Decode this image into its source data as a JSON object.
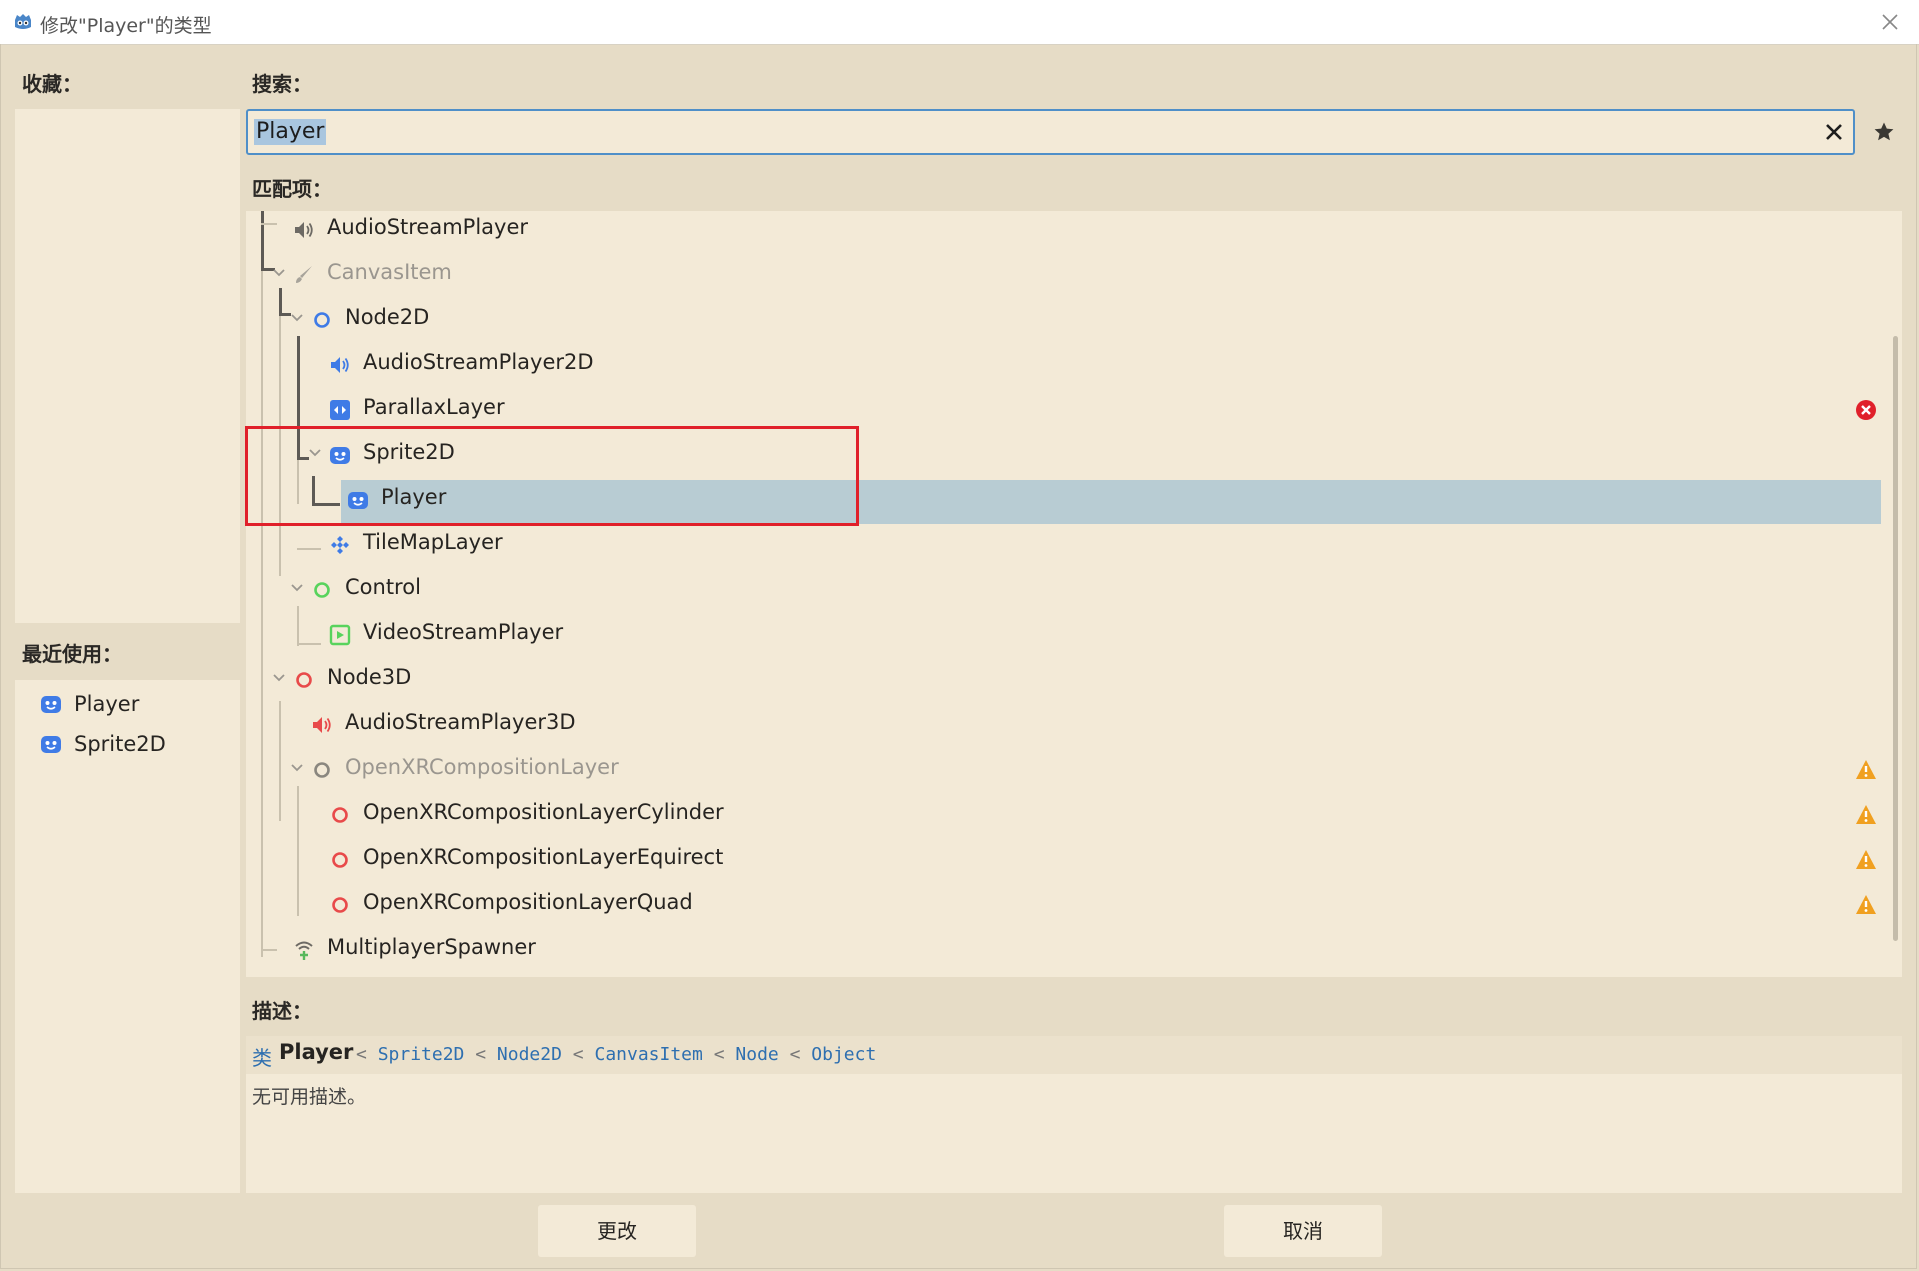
{
  "window": {
    "title": "修改\"Player\"的类型"
  },
  "favorites": {
    "label": "收藏："
  },
  "recent": {
    "label": "最近使用：",
    "items": [
      {
        "label": "Player",
        "icon": "sprite2d-icon"
      },
      {
        "label": "Sprite2D",
        "icon": "sprite2d-icon"
      }
    ]
  },
  "search": {
    "label": "搜索：",
    "value": "Player"
  },
  "matches": {
    "label": "匹配项：",
    "rows": [
      {
        "label": "AudioStreamPlayer",
        "icon": "speaker-icon"
      },
      {
        "label": "CanvasItem",
        "icon": "brush-icon",
        "dim": true
      },
      {
        "label": "Node2D",
        "icon": "node2d-icon"
      },
      {
        "label": "AudioStreamPlayer2D",
        "icon": "speaker-icon"
      },
      {
        "label": "ParallaxLayer",
        "icon": "parallax-icon",
        "status": "error"
      },
      {
        "label": "Sprite2D",
        "icon": "sprite2d-icon"
      },
      {
        "label": "Player",
        "icon": "sprite2d-icon",
        "selected": true
      },
      {
        "label": "TileMapLayer",
        "icon": "tilemap-icon"
      },
      {
        "label": "Control",
        "icon": "control-icon"
      },
      {
        "label": "VideoStreamPlayer",
        "icon": "video-icon"
      },
      {
        "label": "Node3D",
        "icon": "node3d-icon"
      },
      {
        "label": "AudioStreamPlayer3D",
        "icon": "speaker-icon"
      },
      {
        "label": "OpenXRCompositionLayer",
        "icon": "node3d-icon",
        "dim": true,
        "status": "warning"
      },
      {
        "label": "OpenXRCompositionLayerCylinder",
        "icon": "node3d-icon",
        "status": "warning"
      },
      {
        "label": "OpenXRCompositionLayerEquirect",
        "icon": "node3d-icon",
        "status": "warning"
      },
      {
        "label": "OpenXRCompositionLayerQuad",
        "icon": "node3d-icon",
        "status": "warning"
      },
      {
        "label": "MultiplayerSpawner",
        "icon": "multiplayer-icon"
      }
    ]
  },
  "description": {
    "label": "描述：",
    "class_word": "类",
    "class_name": "Player",
    "inherits": [
      "Sprite2D",
      "Node2D",
      "CanvasItem",
      "Node",
      "Object"
    ],
    "separator": "<",
    "text": "无可用描述。"
  },
  "buttons": {
    "change": "更改",
    "cancel": "取消"
  },
  "colors": {
    "background": "#e6dcc6",
    "panel": "#f3ead7",
    "selection": "#b8ccd3",
    "accent_blue": "#2e6fb0",
    "node2d_blue": "#3f7be6",
    "control_green": "#58d35c",
    "node3d_red": "#e84a4a",
    "warning": "#f0a020",
    "error": "#e0202a"
  }
}
